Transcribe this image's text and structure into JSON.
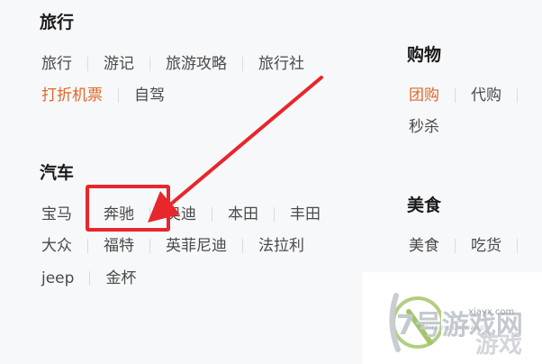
{
  "travel": {
    "title": "旅行",
    "row1": [
      "旅行",
      "游记",
      "旅游攻略",
      "旅行社"
    ],
    "row2": [
      "打折机票",
      "自驾"
    ]
  },
  "shopping": {
    "title": "购物",
    "row1": [
      "团购",
      "代购"
    ],
    "row2": [
      "秒杀"
    ]
  },
  "cars": {
    "title": "汽车",
    "row1": [
      "宝马",
      "奔驰",
      "奥迪",
      "本田",
      "丰田"
    ],
    "row2": [
      "大众",
      "福特",
      "英菲尼迪",
      "法拉利"
    ],
    "row3": [
      "jeep",
      "金杯"
    ]
  },
  "food": {
    "title": "美食",
    "row1": [
      "美食",
      "吃货"
    ]
  },
  "watermark": {
    "brand": "7号游戏网",
    "brand2": "游戏",
    "url": "xjayx.com",
    "pinyin": "7HAOYOUXIWANG"
  },
  "annotation": {
    "color": "#e8262b"
  },
  "colors": {
    "hot": "#e0672a",
    "text": "#4a4a4a",
    "title": "#1a1a1a"
  }
}
